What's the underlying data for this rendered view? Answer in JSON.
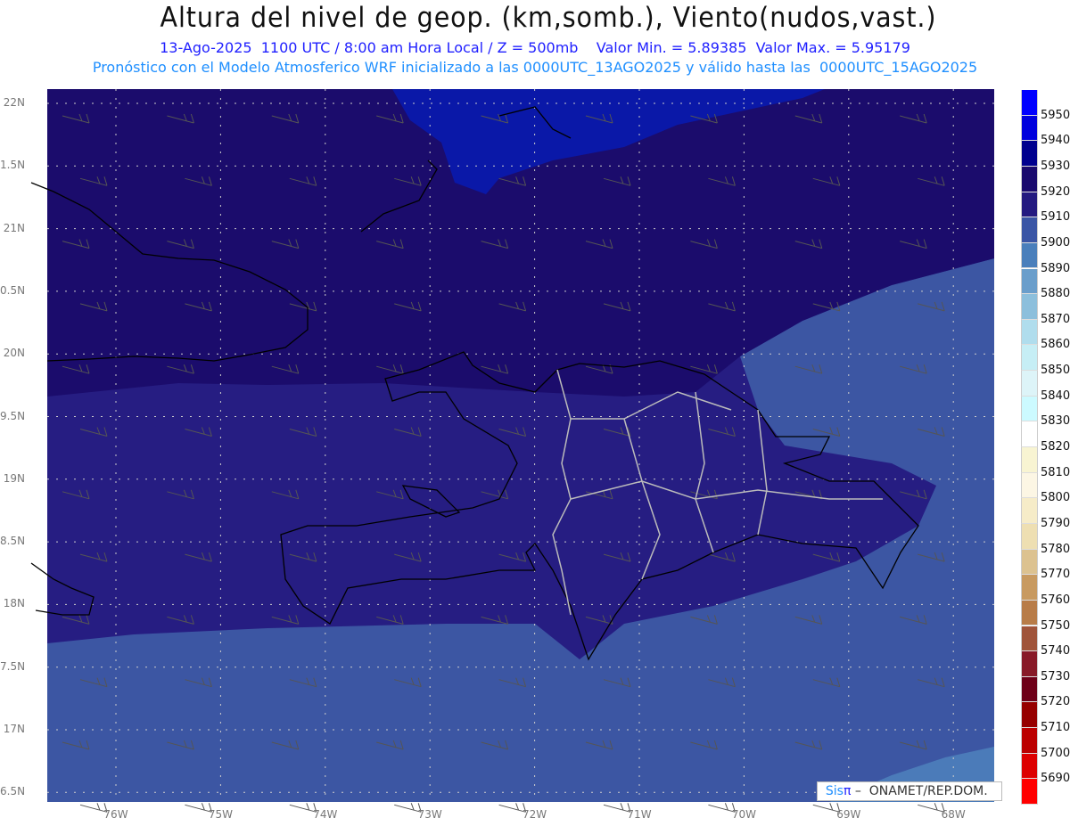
{
  "title": "Altura del nivel de geop. (km,somb.), Viento(nudos,vast.)",
  "subtitle": "13-Ago-2025  1100 UTC / 8:00 am Hora Local / Z = 500mb    Valor Min. = 5.89385  Valor Max. = 5.95179",
  "subtitle2": "Pronóstico con el Modelo Atmosferico WRF inicializado a las 0000UTC_13AGO2025 y válido hasta las  0000UTC_15AGO2025",
  "lat_labels": [
    "22N",
    "1.5N",
    "21N",
    "0.5N",
    "20N",
    "9.5N",
    "19N",
    "8.5N",
    "18N",
    "7.5N",
    "17N",
    "6.5N"
  ],
  "lon_labels": [
    "76W",
    "75W",
    "74W",
    "73W",
    "72W",
    "71W",
    "70W",
    "69W",
    "68W"
  ],
  "colorbar": {
    "labels": [
      "5950",
      "5940",
      "5930",
      "5920",
      "5910",
      "5900",
      "5890",
      "5880",
      "5870",
      "5860",
      "5850",
      "5840",
      "5830",
      "5820",
      "5810",
      "5800",
      "5790",
      "5780",
      "5770",
      "5760",
      "5750",
      "5740",
      "5730",
      "5720",
      "5710",
      "5700",
      "5690"
    ],
    "colors": [
      "#0000ff",
      "#0000dd",
      "#00008e",
      "#1a0a6e",
      "#241a80",
      "#3a55a5",
      "#4a7fbb",
      "#6a9ecb",
      "#8cbfdc",
      "#b0dded",
      "#c6eef5",
      "#ddf4f8",
      "#ccfaff",
      "#ffffff",
      "#f8f4d2",
      "#fcf6e4",
      "#f6ecc8",
      "#eedfb2",
      "#dcc290",
      "#c89a60",
      "#b87c48",
      "#a0543a",
      "#881a28",
      "#6e0018",
      "#960000",
      "#bb0000",
      "#dd0000",
      "#ff0000"
    ]
  },
  "field_colors": {
    "band_5930_5940": "#0a18a8",
    "band_5920_5930": "#1b0c6c",
    "band_5910_5920": "#261d82",
    "band_5900_5910": "#3c56a3",
    "band_5890_5900": "#4b7bb9"
  },
  "logo": {
    "sis": "Sis",
    "pi": "π",
    "text": " –  ONAMET/REP.DOM."
  }
}
